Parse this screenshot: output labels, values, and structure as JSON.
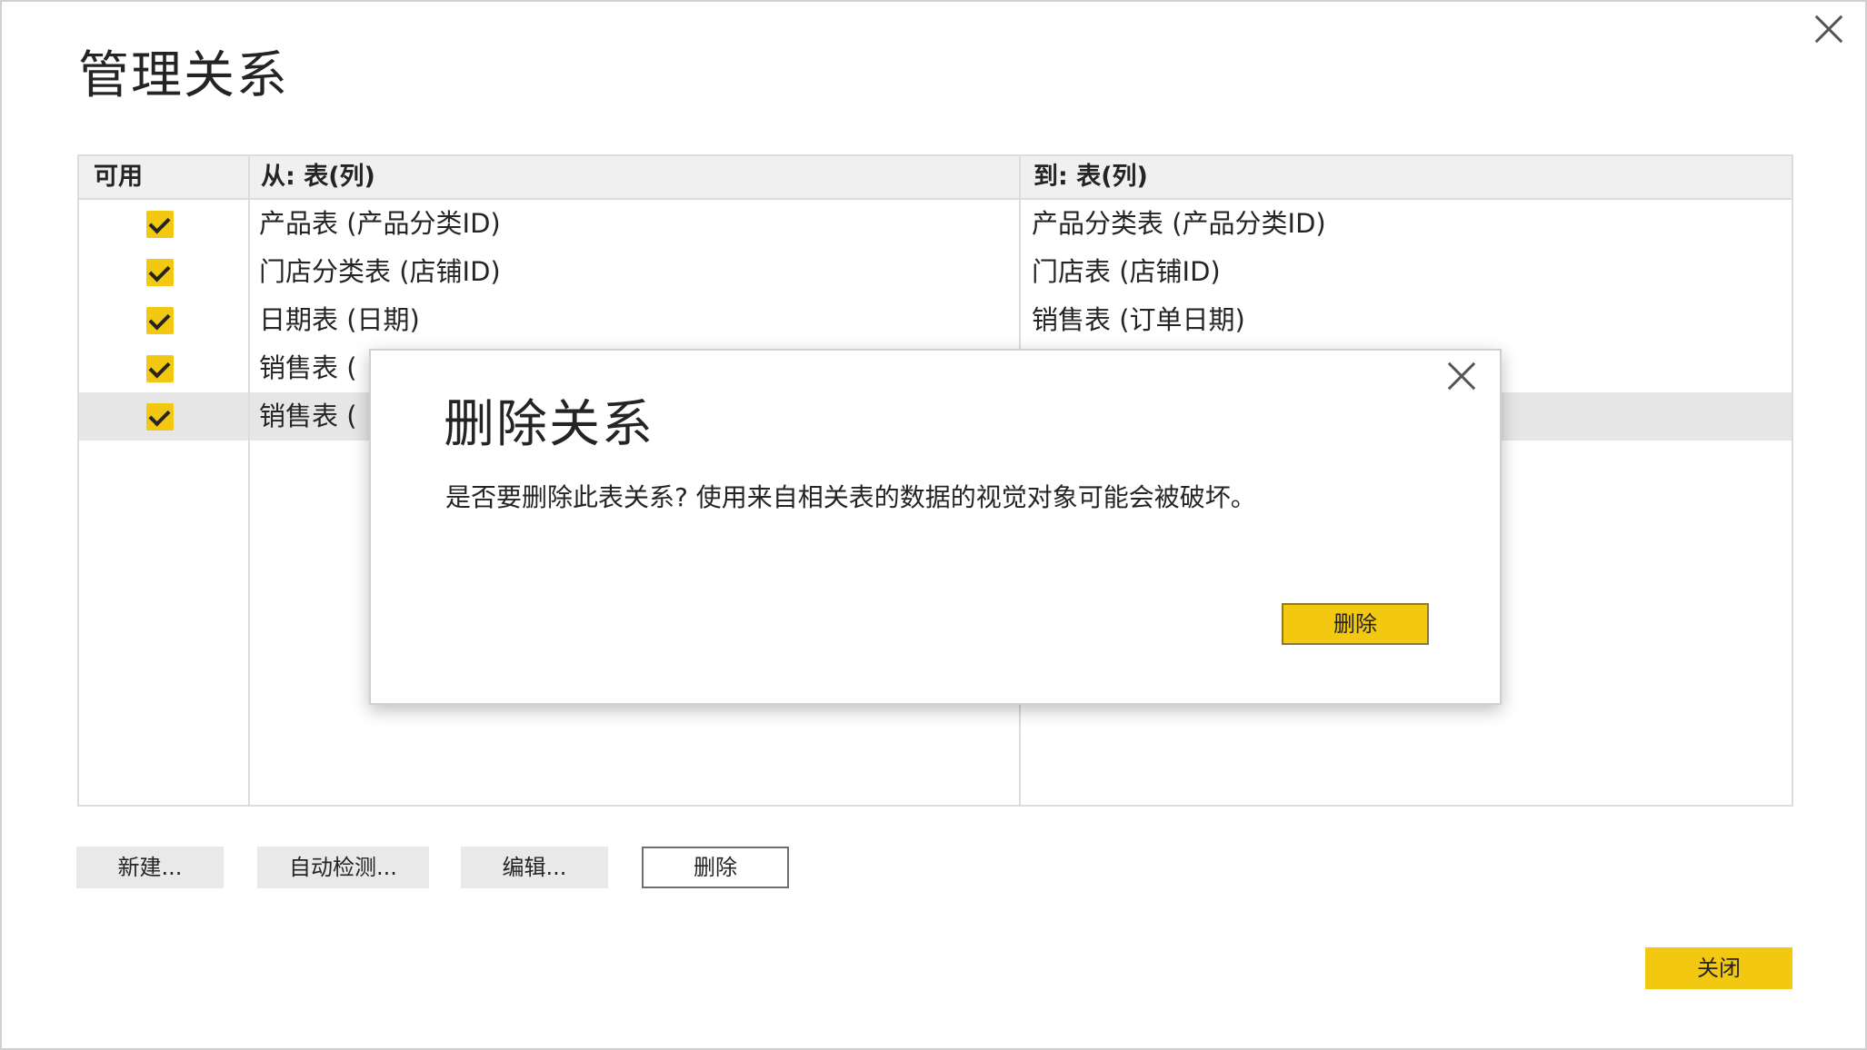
{
  "window": {
    "title": "管理关系"
  },
  "table": {
    "headers": {
      "active": "可用",
      "from": "从: 表(列)",
      "to": "到: 表(列)"
    },
    "rows": [
      {
        "from": "产品表 (产品分类ID)",
        "to": "产品分类表 (产品分类ID)"
      },
      {
        "from": "门店分类表 (店铺ID)",
        "to": "门店表 (店铺ID)"
      },
      {
        "from": "日期表 (日期)",
        "to": "销售表 (订单日期)"
      },
      {
        "from": "销售表 (",
        "to": ""
      },
      {
        "from": "销售表 (",
        "to": ""
      }
    ]
  },
  "toolbar": {
    "new_label": "新建...",
    "autodetect_label": "自动检测...",
    "edit_label": "编辑...",
    "delete_label": "删除"
  },
  "footer": {
    "close_label": "关闭"
  },
  "dialog": {
    "title": "删除关系",
    "message": "是否要删除此表关系? 使用来自相关表的数据的视觉对象可能会被破坏。",
    "confirm_label": "删除"
  },
  "colors": {
    "accent": "#f2c811",
    "header_bg": "#f0f0f0",
    "selected_row": "#e6e6e6"
  }
}
